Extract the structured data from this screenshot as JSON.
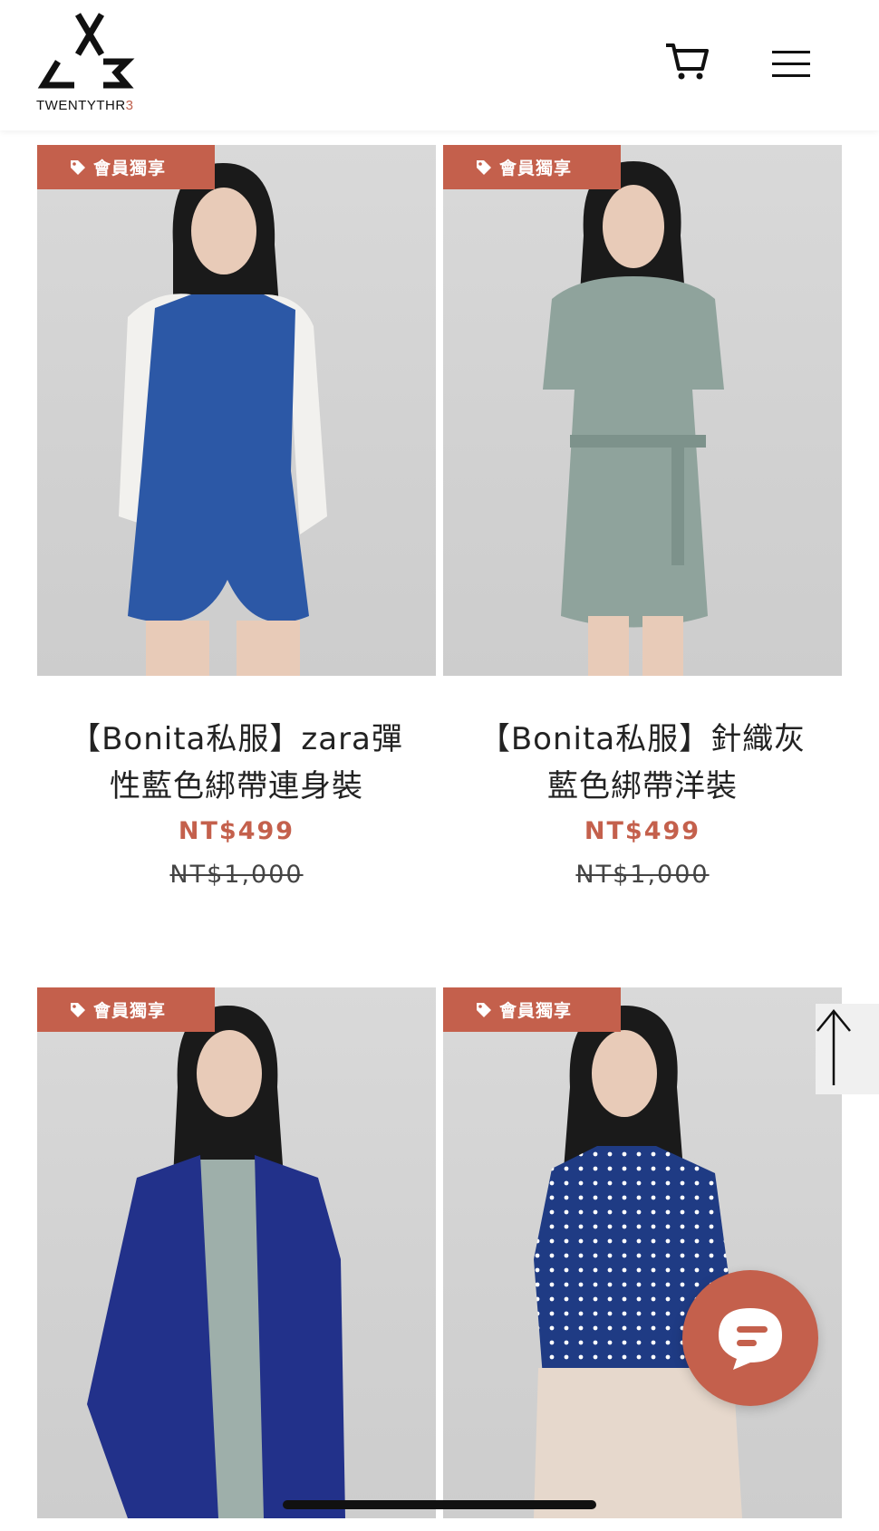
{
  "brand": {
    "name_main": "TWENTYTHR",
    "name_accent": "3"
  },
  "badge_label": "會員獨享",
  "products": [
    {
      "title_line1": "【Bonita私服】zara彈",
      "title_line2": "性藍色綁帶連身裝",
      "price": "NT$499",
      "original_price": "NT$1,000",
      "garment_color": "#2c58a6"
    },
    {
      "title_line1": "【Bonita私服】針織灰",
      "title_line2": "藍色綁帶洋裝",
      "price": "NT$499",
      "original_price": "NT$1,000",
      "garment_color": "#8fa39c"
    },
    {
      "title_line1": "",
      "title_line2": "",
      "price": "",
      "original_price": "",
      "garment_color": "#22318a"
    },
    {
      "title_line1": "",
      "title_line2": "",
      "price": "",
      "original_price": "",
      "garment_color": "#1f3b84"
    }
  ],
  "colors": {
    "accent": "#c4604c",
    "text": "#222222"
  },
  "icons": [
    "cart-icon",
    "menu-icon",
    "tag-icon",
    "arrow-up-icon",
    "chat-icon"
  ]
}
